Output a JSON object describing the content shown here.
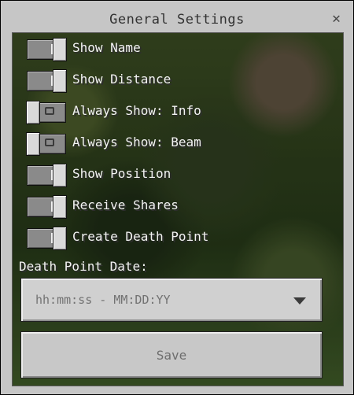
{
  "window": {
    "title": "General Settings",
    "close_glyph": "✕"
  },
  "toggles": [
    {
      "label": "Show Name",
      "state": "on"
    },
    {
      "label": "Show Distance",
      "state": "on"
    },
    {
      "label": "Always Show: Info",
      "state": "off"
    },
    {
      "label": "Always Show: Beam",
      "state": "off"
    },
    {
      "label": "Show Position",
      "state": "on"
    },
    {
      "label": "Receive Shares",
      "state": "on"
    },
    {
      "label": "Create Death Point",
      "state": "on"
    }
  ],
  "death_point": {
    "label": "Death Point Date:",
    "selected": "hh:mm:ss - MM:DD:YY"
  },
  "save_button": {
    "label": "Save"
  },
  "icons": {
    "close": "close-icon",
    "dropdown": "chevron-down-icon"
  }
}
